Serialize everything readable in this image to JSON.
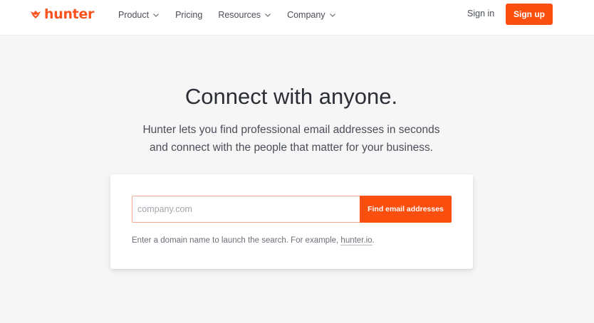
{
  "brand": {
    "name": "hunter",
    "color": "#fa5320",
    "icon": "fox-icon"
  },
  "nav": {
    "items": [
      {
        "label": "Product",
        "dropdown": true
      },
      {
        "label": "Pricing",
        "dropdown": false
      },
      {
        "label": "Resources",
        "dropdown": true
      },
      {
        "label": "Company",
        "dropdown": true
      }
    ],
    "sign_in": "Sign in",
    "sign_up": "Sign up"
  },
  "hero": {
    "title": "Connect with anyone.",
    "subtitle_line1": "Hunter lets you find professional email addresses in seconds",
    "subtitle_line2": "and connect with the people that matter for your business."
  },
  "search": {
    "placeholder": "company.com",
    "value": "",
    "button_label": "Find email addresses",
    "hint_text": "Enter a domain name to launch the search. For example, ",
    "hint_link": "hunter.io",
    "hint_suffix": "."
  },
  "colors": {
    "accent": "#fa4f0f",
    "page_background": "#f6f6f7"
  }
}
